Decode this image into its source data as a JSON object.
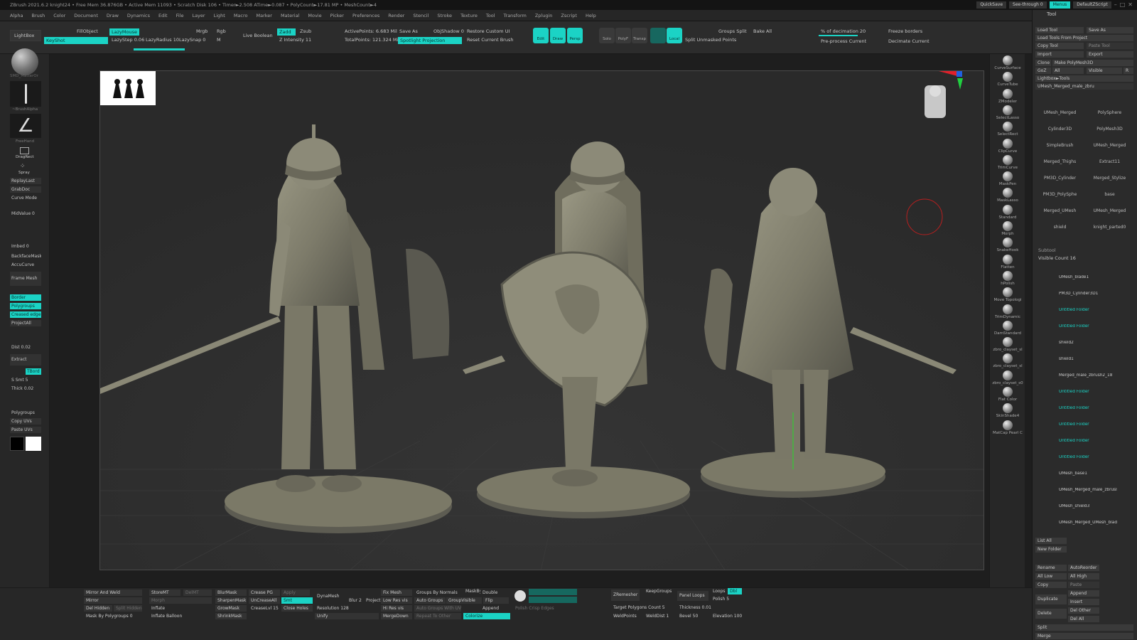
{
  "titlebar": {
    "text": "ZBrush 2021.6.2   knight24   • Free Mem 36.876GB • Active Mem 11093 • Scratch Disk 106 • Timer►2.508 ATime►0.087 • PolyCount►17.81 MP • MeshCount►4",
    "quicksave": "QuickSave",
    "see_through": "See-through  0",
    "menus": "Menus",
    "default_zscript": "DefaultZScript"
  },
  "menubar": [
    "Alpha",
    "Brush",
    "Color",
    "Document",
    "Draw",
    "Dynamics",
    "Edit",
    "File",
    "Layer",
    "Light",
    "Macro",
    "Marker",
    "Material",
    "Movie",
    "Picker",
    "Preferences",
    "Render",
    "Stencil",
    "Stroke",
    "Texture",
    "Tool",
    "Transform",
    "Zplugin",
    "Zscript",
    "Help"
  ],
  "topshelf": {
    "lightbox": "LightBox",
    "fillobject": "FillObject",
    "lazymouse": "LazyMouse",
    "keyshot": "KeyShot",
    "lazystep": "LazyStep  0.06",
    "lazyradius": "LazyRadius  10",
    "lazysnap": "LazySnap  0",
    "mrgb": "Mrgb",
    "rgb": "Rgb",
    "m": "M",
    "live_boolean": "Live Boolean",
    "zadd": "Zadd",
    "zsub": "Zsub",
    "z_intensity": "Z Intensity  11",
    "active_points": "ActivePoints: 6.683 Mil",
    "total_points": "TotalPoints: 121.324 Mil",
    "save_as": "Save As",
    "spotlight": "Spotlight Projection",
    "obj_shadow": "ObjShadow  0",
    "restore_brush": "Restore Custom UI",
    "reset_brush": "Reset Current Brush",
    "edit": "Edit",
    "draw": "Draw",
    "persp": "Persp",
    "solo": "Solo",
    "polyf": "PolyF",
    "transp": "Transp",
    "local": "Local",
    "groups_split": "Groups Split",
    "split_unmasked": "Split Unmasked Points",
    "bake_all": "Bake All",
    "decimation": "% of decimation  20",
    "preprocess": "Pre-process Current",
    "freeze_borders": "Freeze borders",
    "decimate_current": "Decimate Current"
  },
  "leftshelf": {
    "material_label": "SMD_MatterOr",
    "brush_alpha": "~BrushAlpha",
    "stroke": "FreeHand",
    "dragrect": "DragRect",
    "spray": "Spray",
    "replay": "ReplayLast",
    "grabdoc": "GrabDoc",
    "curve_mode": "Curve Mode",
    "midvalue": "MidValue  0",
    "imbed": "Imbed  0",
    "backface": "BackfaceMask",
    "accucurve": "AccuCurve",
    "frame_mesh": "Frame Mesh",
    "border": "Border",
    "polygroups": "Polygroups",
    "creased": "Creased edge",
    "project_all": "ProjectAll",
    "dist": "Dist  0.02",
    "extract": "Extract",
    "tbord": "TBord",
    "s_smt": "S Smt  5",
    "thick": "Thick  0.02",
    "polygroups2": "Polygroups",
    "copy_uvs": "Copy UVs",
    "paste_uvs": "Paste UVs"
  },
  "rightshelf": [
    "CurveSurface",
    "CurveTube",
    "ZModeler",
    "SelectLasso",
    "SelectRect",
    "ClipCurve",
    "TrimCurve",
    "MaskPen",
    "MaskLasso",
    "Standard",
    "Morph",
    "SnakeHook",
    "Flatten",
    "hPolish",
    "Move Topologi",
    "TrimDynamic",
    "DamStandard",
    "zbro_clayset_sl",
    "zbro_clayset_sl",
    "zbro_clayset_s0",
    "Flat Color",
    "SkinShade4",
    "MatCap Pearl C"
  ],
  "toolpalette": {
    "title": "Tool",
    "load_tool": "Load Tool",
    "save_as": "Save As",
    "load_from_project": "Load Tools From Project",
    "copy_tool": "Copy Tool",
    "paste_tool": "Paste Tool",
    "import": "Import",
    "export": "Export",
    "clone": "Clone",
    "make_polymesh": "Make PolyMesh3D",
    "goz": "GoZ",
    "all": "All",
    "visible": "Visible",
    "r": "R",
    "lightbox_tools": "Lightbox►Tools",
    "current_tool": "UMesh_Merged_male_zbru",
    "tools": [
      "UMesh_Merged",
      "PolySphere",
      "Cylinder3D",
      "PolyMesh3D",
      "SimpleBrush",
      "UMesh_Merged",
      "Merged_Thighs",
      "Extract11",
      "PM3D_Cylinder",
      "Merged_Stylize",
      "PM3D_PolySphe",
      "base",
      "Merged_UMesh",
      "UMesh_Merged",
      "shield",
      "knight_parted0"
    ],
    "subtool": "Subtool",
    "visible_count": "Visible Count  16",
    "subtools": [
      "UMesh_blade1",
      "PM3D_Cylinder3D1",
      "Untitled Folder",
      "Untitled Folder",
      "shield2",
      "shield1",
      "Merged_male_zbrush2_18",
      "Untitled Folder",
      "Untitled Folder",
      "Untitled Folder",
      "Untitled Folder",
      "Untitled Folder",
      "UMesh_base1",
      "UMesh_Merged_male_zbrusl",
      "UMesh_shield3",
      "UMesh_Merged_UMesh_blad"
    ],
    "list_all": "List All",
    "new_folder": "New Folder",
    "rename": "Rename",
    "autoreorder": "AutoReorder",
    "all_low": "All Low",
    "all_high": "All High",
    "copy": "Copy",
    "paste": "Paste",
    "append": "Append",
    "duplicate": "Duplicate",
    "insert": "Insert",
    "delete": "Delete",
    "del_other": "Del Other",
    "del_all": "Del All",
    "split": "Split",
    "merge": "Merge"
  },
  "bottomshelf": {
    "mirror_weld": "Mirror And Weld",
    "mirror": "Mirror",
    "del_hidden": "Del Hidden",
    "split_hidden": "Split Hidden",
    "mask_polygroups": "Mask By Polygroups  0",
    "storemt": "StoreMT",
    "delmt": "DelMT",
    "morph": "Morph",
    "inflate": "Inflate",
    "inflate_balloon": "Inflate Balloon",
    "blurmask": "BlurMask",
    "sharpenmask": "SharpenMask",
    "growmask": "GrowMask",
    "shrinkmask": "ShrinkMask",
    "crease_pg": "Crease PG",
    "uncrease_all": "UnCreaseAll",
    "creaselvl": "CreaseLvl  15",
    "apply": "Apply",
    "smt": "Smt",
    "close_holes": "Close Holes",
    "dynamesh": "DynaMesh",
    "blur": "Blur  2",
    "project": "Project",
    "resolution": "Resolution  128",
    "unify": "Unify",
    "fix_mesh": "Fix Mesh",
    "low_res": "Low Res vis",
    "hi_res": "Hi Res vis",
    "merge_down": "MergeDown",
    "groups_normals": "Groups By Normals",
    "auto_groups": "Auto Groups",
    "auto_groups_uv": "Auto Groups With UV",
    "repeat_other": "Repeat To Other",
    "maskby": "MaskBy",
    "double": "Double",
    "group_visible": "GroupVisible",
    "flip": "Flip",
    "append": "Append",
    "colorize": "Colorize",
    "polish_crisp": "Polish Crisp Edges",
    "zremesher": "ZRemesher",
    "keepgroups": "KeepGroups",
    "target_polys": "Target Polygons Count  5",
    "weldpoints": "WeldPoints",
    "welddist": "WeldDist  1",
    "panel_loops": "Panel Loops",
    "loops": "Loops",
    "dbl": "Dbl",
    "polish": "Polish  5",
    "thickness": "Thickness  0.01",
    "bevel": "Bevel  50",
    "elevation": "Elevation  100"
  },
  "colors": {
    "accent": "#1bd3c5",
    "bg": "#1e1e1e",
    "canvas": "#2d2d2d",
    "model": "#807e6c"
  }
}
